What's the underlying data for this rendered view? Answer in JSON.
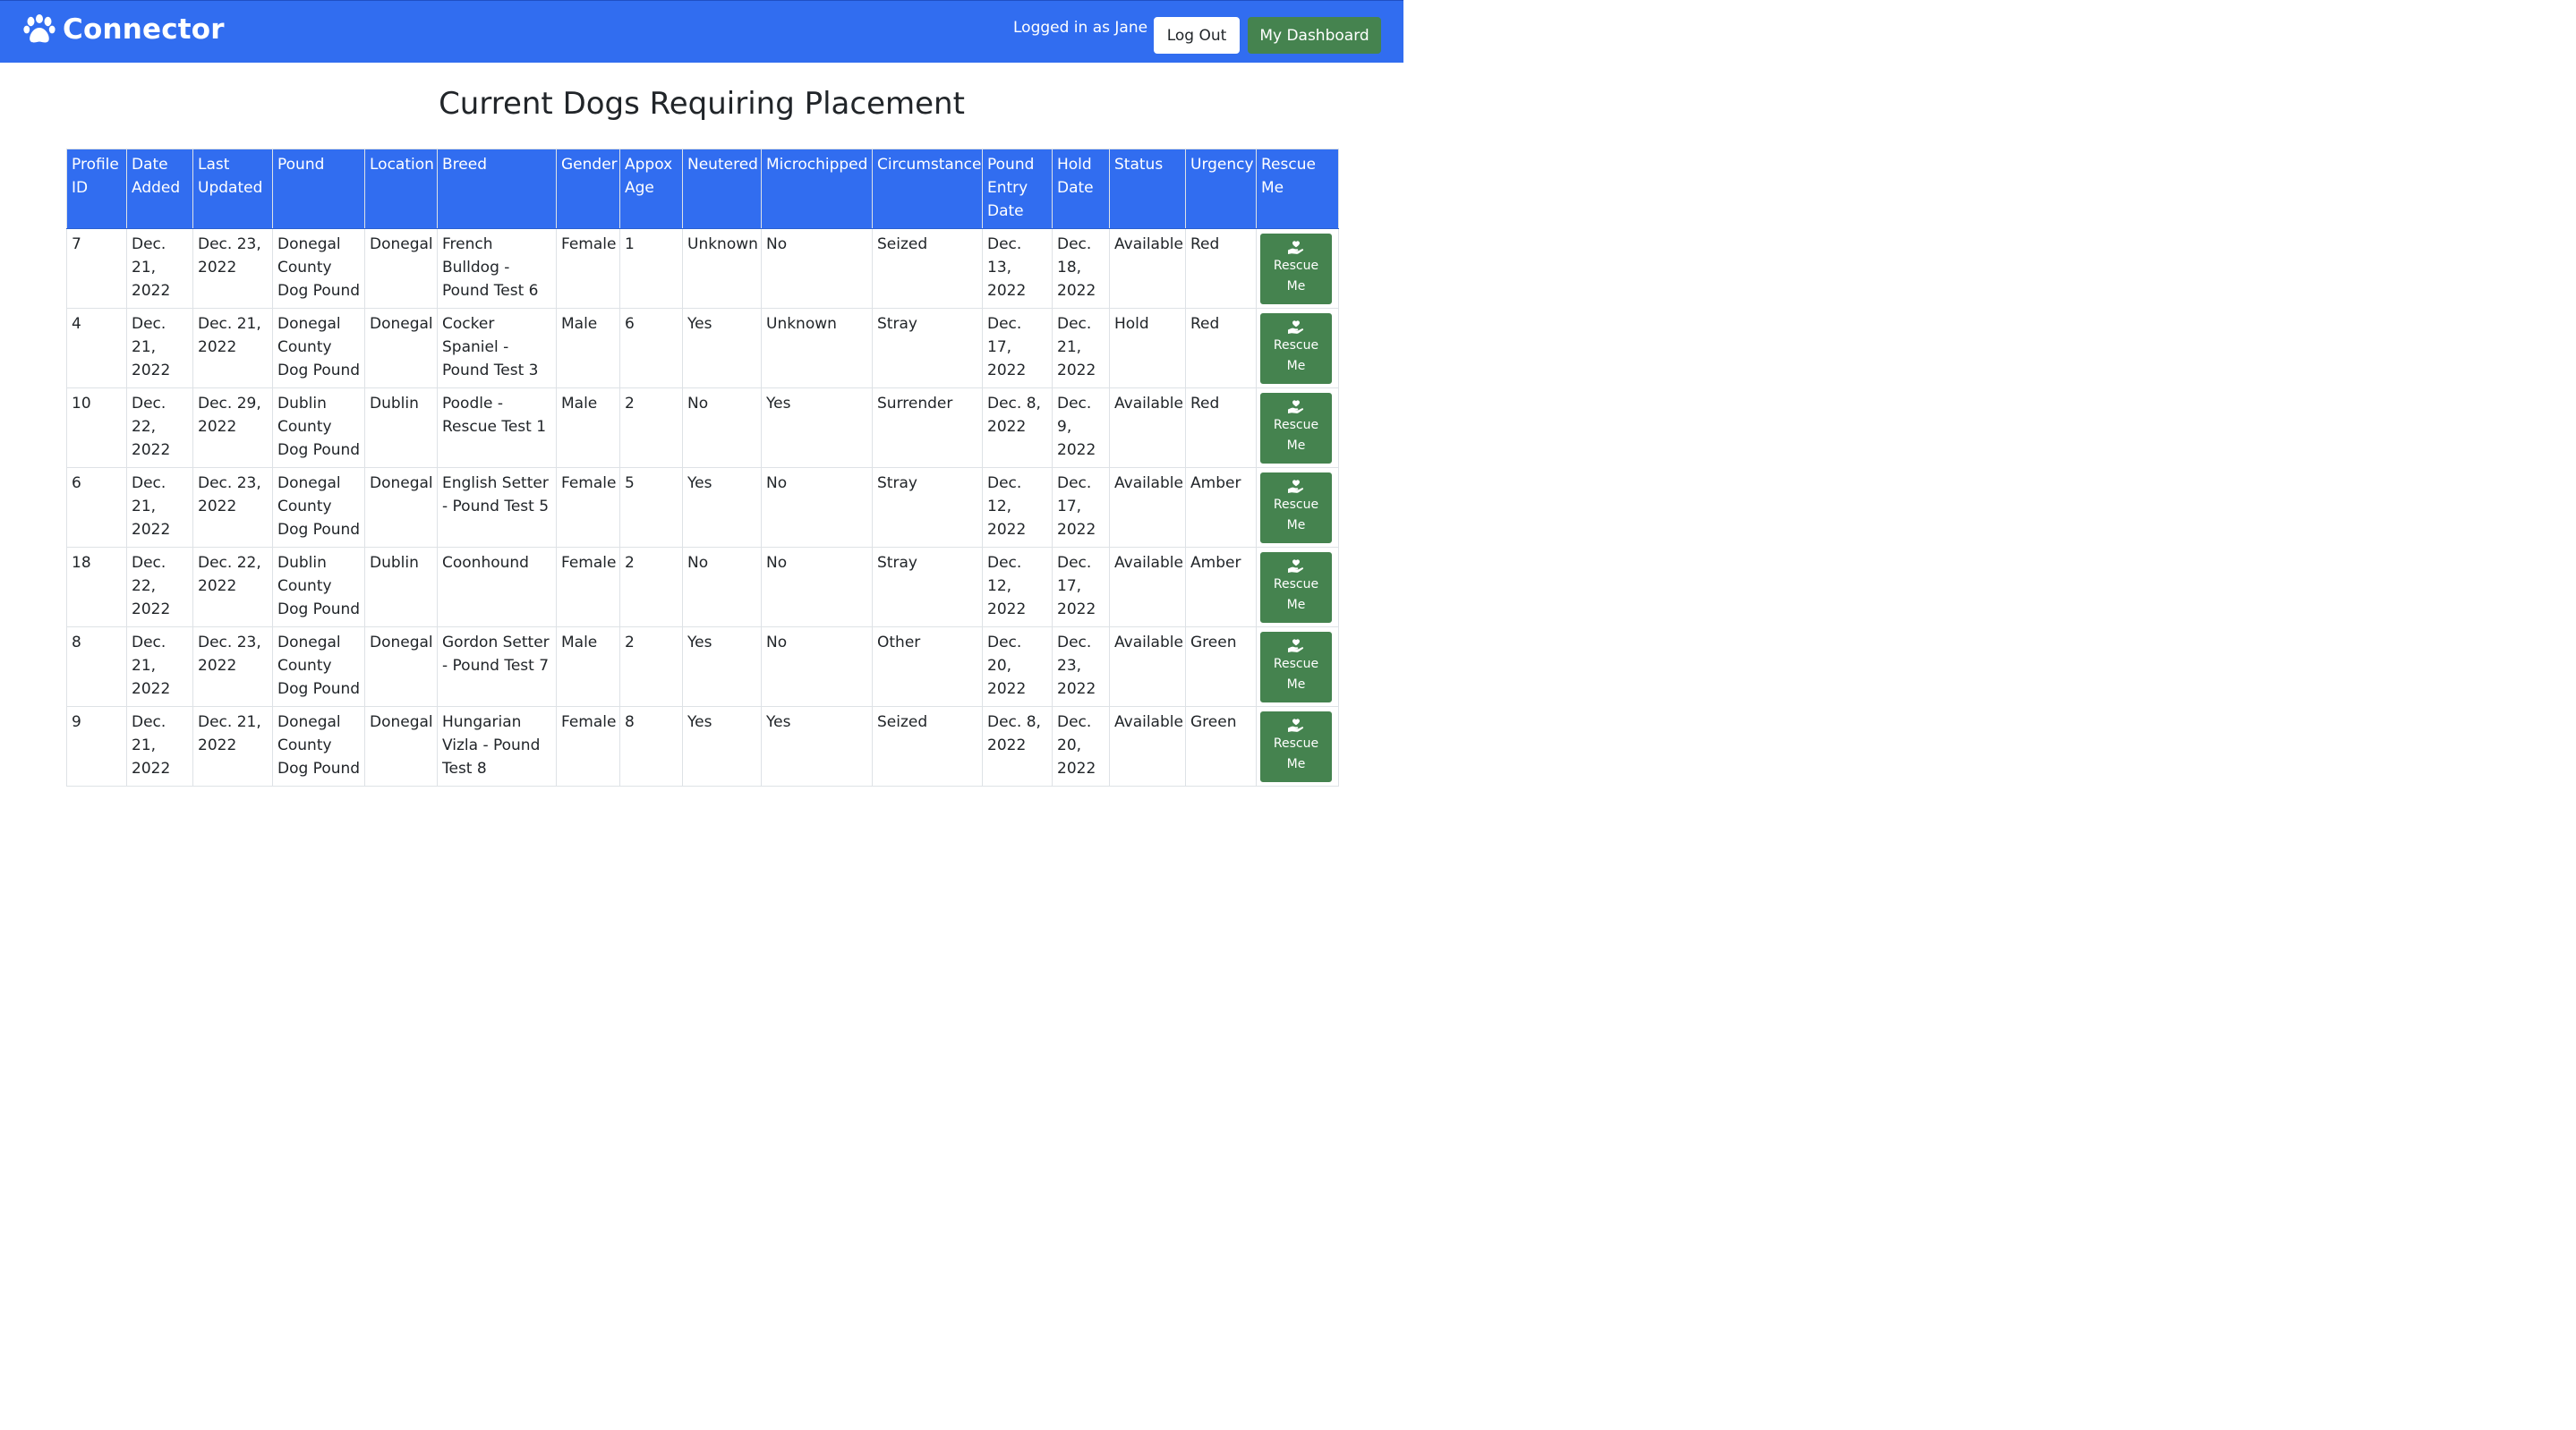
{
  "app": {
    "title": "Connector"
  },
  "nav": {
    "logged_in_text": "Logged in as Jane",
    "logout_label": "Log Out",
    "dashboard_label": "My Dashboard"
  },
  "page": {
    "heading": "Current Dogs Requiring Placement"
  },
  "table": {
    "headers": [
      "Profile ID",
      "Date Added",
      "Last Updated",
      "Pound",
      "Location",
      "Breed",
      "Gender",
      "Appox Age",
      "Neutered",
      "Microchipped",
      "Circumstance",
      "Pound Entry Date",
      "Hold Date",
      "Status",
      "Urgency",
      "Rescue Me"
    ],
    "rescue_label": "Rescue Me",
    "rows": [
      {
        "id": "7",
        "date_added": "Dec. 21, 2022",
        "last_updated": "Dec. 23, 2022",
        "pound": "Donegal County Dog Pound",
        "location": "Donegal",
        "breed": "French Bulldog - Pound Test 6",
        "gender": "Female",
        "age": "1",
        "neutered": "Unknown",
        "microchipped": "No",
        "circumstance": "Seized",
        "entry_date": "Dec. 13, 2022",
        "hold_date": "Dec. 18, 2022",
        "status": "Available",
        "urgency": "Red"
      },
      {
        "id": "4",
        "date_added": "Dec. 21, 2022",
        "last_updated": "Dec. 21, 2022",
        "pound": "Donegal County Dog Pound",
        "location": "Donegal",
        "breed": "Cocker Spaniel - Pound Test 3",
        "gender": "Male",
        "age": "6",
        "neutered": "Yes",
        "microchipped": "Unknown",
        "circumstance": "Stray",
        "entry_date": "Dec. 17, 2022",
        "hold_date": "Dec. 21, 2022",
        "status": "Hold",
        "urgency": "Red"
      },
      {
        "id": "10",
        "date_added": "Dec. 22, 2022",
        "last_updated": "Dec. 29, 2022",
        "pound": "Dublin County Dog Pound",
        "location": "Dublin",
        "breed": "Poodle - Rescue Test 1",
        "gender": "Male",
        "age": "2",
        "neutered": "No",
        "microchipped": "Yes",
        "circumstance": "Surrender",
        "entry_date": "Dec. 8, 2022",
        "hold_date": "Dec. 9, 2022",
        "status": "Available",
        "urgency": "Red"
      },
      {
        "id": "6",
        "date_added": "Dec. 21, 2022",
        "last_updated": "Dec. 23, 2022",
        "pound": "Donegal County Dog Pound",
        "location": "Donegal",
        "breed": "English Setter - Pound Test 5",
        "gender": "Female",
        "age": "5",
        "neutered": "Yes",
        "microchipped": "No",
        "circumstance": "Stray",
        "entry_date": "Dec. 12, 2022",
        "hold_date": "Dec. 17, 2022",
        "status": "Available",
        "urgency": "Amber"
      },
      {
        "id": "18",
        "date_added": "Dec. 22, 2022",
        "last_updated": "Dec. 22, 2022",
        "pound": "Dublin County Dog Pound",
        "location": "Dublin",
        "breed": "Coonhound",
        "gender": "Female",
        "age": "2",
        "neutered": "No",
        "microchipped": "No",
        "circumstance": "Stray",
        "entry_date": "Dec. 12, 2022",
        "hold_date": "Dec. 17, 2022",
        "status": "Available",
        "urgency": "Amber"
      },
      {
        "id": "8",
        "date_added": "Dec. 21, 2022",
        "last_updated": "Dec. 23, 2022",
        "pound": "Donegal County Dog Pound",
        "location": "Donegal",
        "breed": "Gordon Setter - Pound Test 7",
        "gender": "Male",
        "age": "2",
        "neutered": "Yes",
        "microchipped": "No",
        "circumstance": "Other",
        "entry_date": "Dec. 20, 2022",
        "hold_date": "Dec. 23, 2022",
        "status": "Available",
        "urgency": "Green"
      },
      {
        "id": "9",
        "date_added": "Dec. 21, 2022",
        "last_updated": "Dec. 21, 2022",
        "pound": "Donegal County Dog Pound",
        "location": "Donegal",
        "breed": "Hungarian Vizla - Pound Test 8",
        "gender": "Female",
        "age": "8",
        "neutered": "Yes",
        "microchipped": "Yes",
        "circumstance": "Seized",
        "entry_date": "Dec. 8, 2022",
        "hold_date": "Dec. 20, 2022",
        "status": "Available",
        "urgency": "Green"
      }
    ]
  },
  "colors": {
    "primary": "#316df0",
    "success": "#45834f",
    "text": "#212529",
    "border": "#dee2e6"
  },
  "icons": {
    "brand": "paw-icon",
    "rescue": "hand-holding-heart-icon"
  }
}
